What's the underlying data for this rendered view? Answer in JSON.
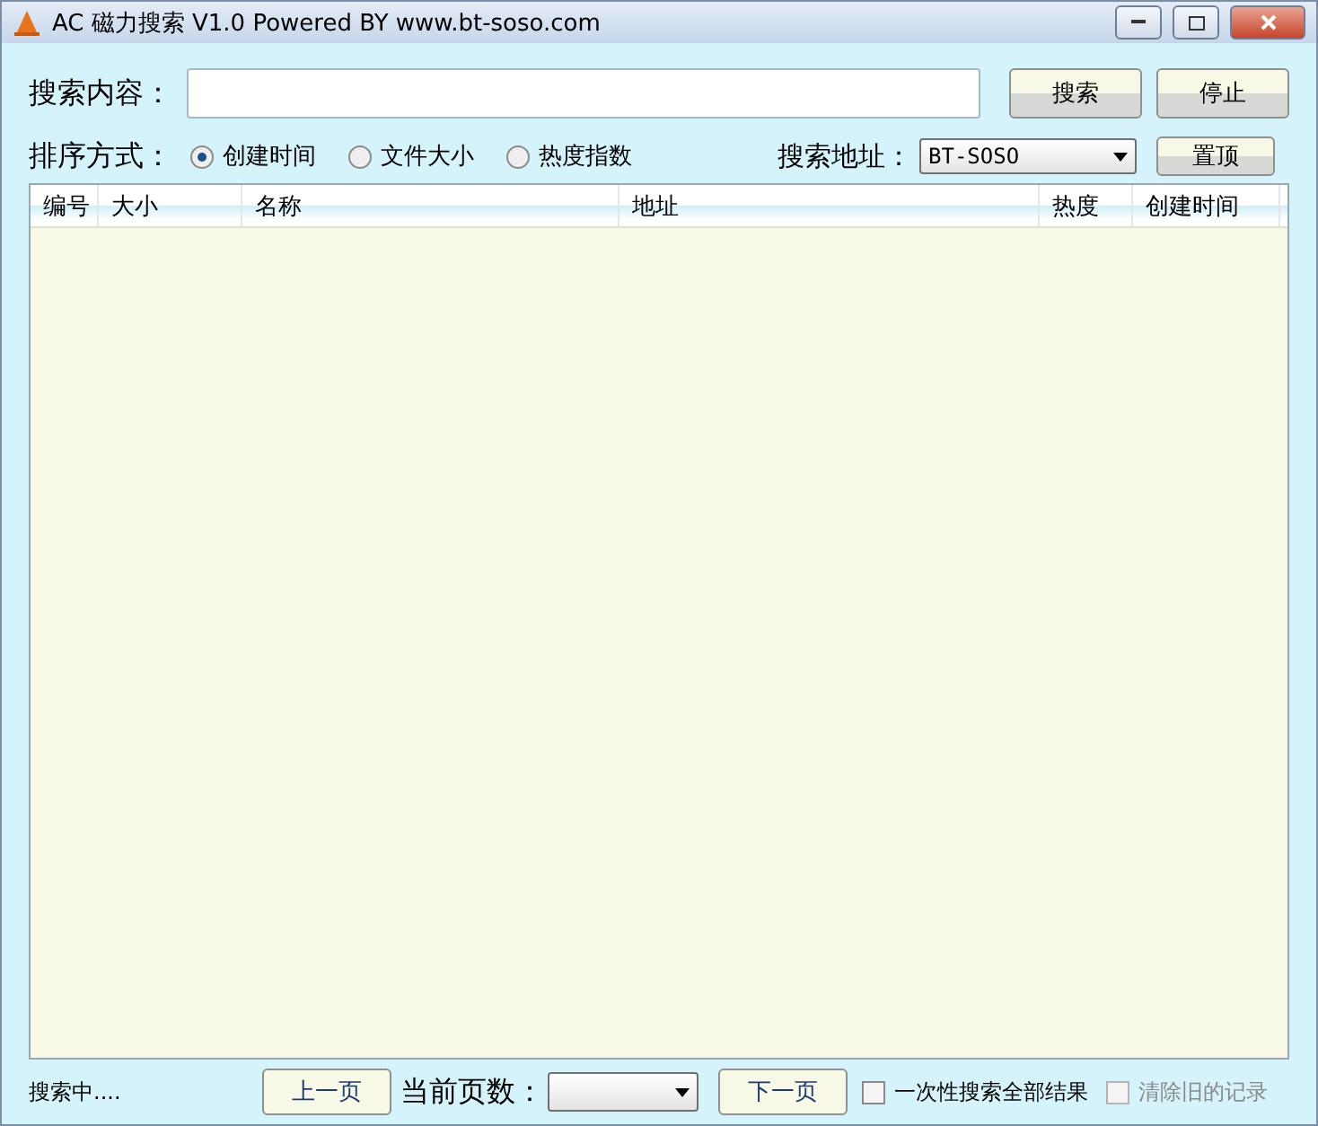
{
  "window": {
    "title": "AC 磁力搜索 V1.0 Powered BY www.bt-soso.com"
  },
  "search": {
    "label": "搜索内容：",
    "buttons": [
      "搜索",
      "停止"
    ]
  },
  "sort": {
    "label": "排序方式：",
    "options": [
      {
        "label": "创建时间",
        "selected": true
      },
      {
        "label": "文件大小",
        "selected": false
      },
      {
        "label": "热度指数",
        "selected": false
      }
    ]
  },
  "source": {
    "label": "搜索地址：",
    "value": "BT-SOSO",
    "button": "置顶"
  },
  "table": {
    "columns": [
      "编号",
      "大小",
      "名称",
      "地址",
      "热度",
      "创建时间"
    ]
  },
  "status_bar": {
    "status": "搜索中....",
    "prev": "上一页",
    "page_label": "当前页数：",
    "next": "下一页",
    "options": [
      {
        "label": "一次性搜索全部结果",
        "checked": false,
        "disabled": false
      },
      {
        "label": "清除旧的记录",
        "checked": false,
        "disabled": true
      }
    ]
  }
}
